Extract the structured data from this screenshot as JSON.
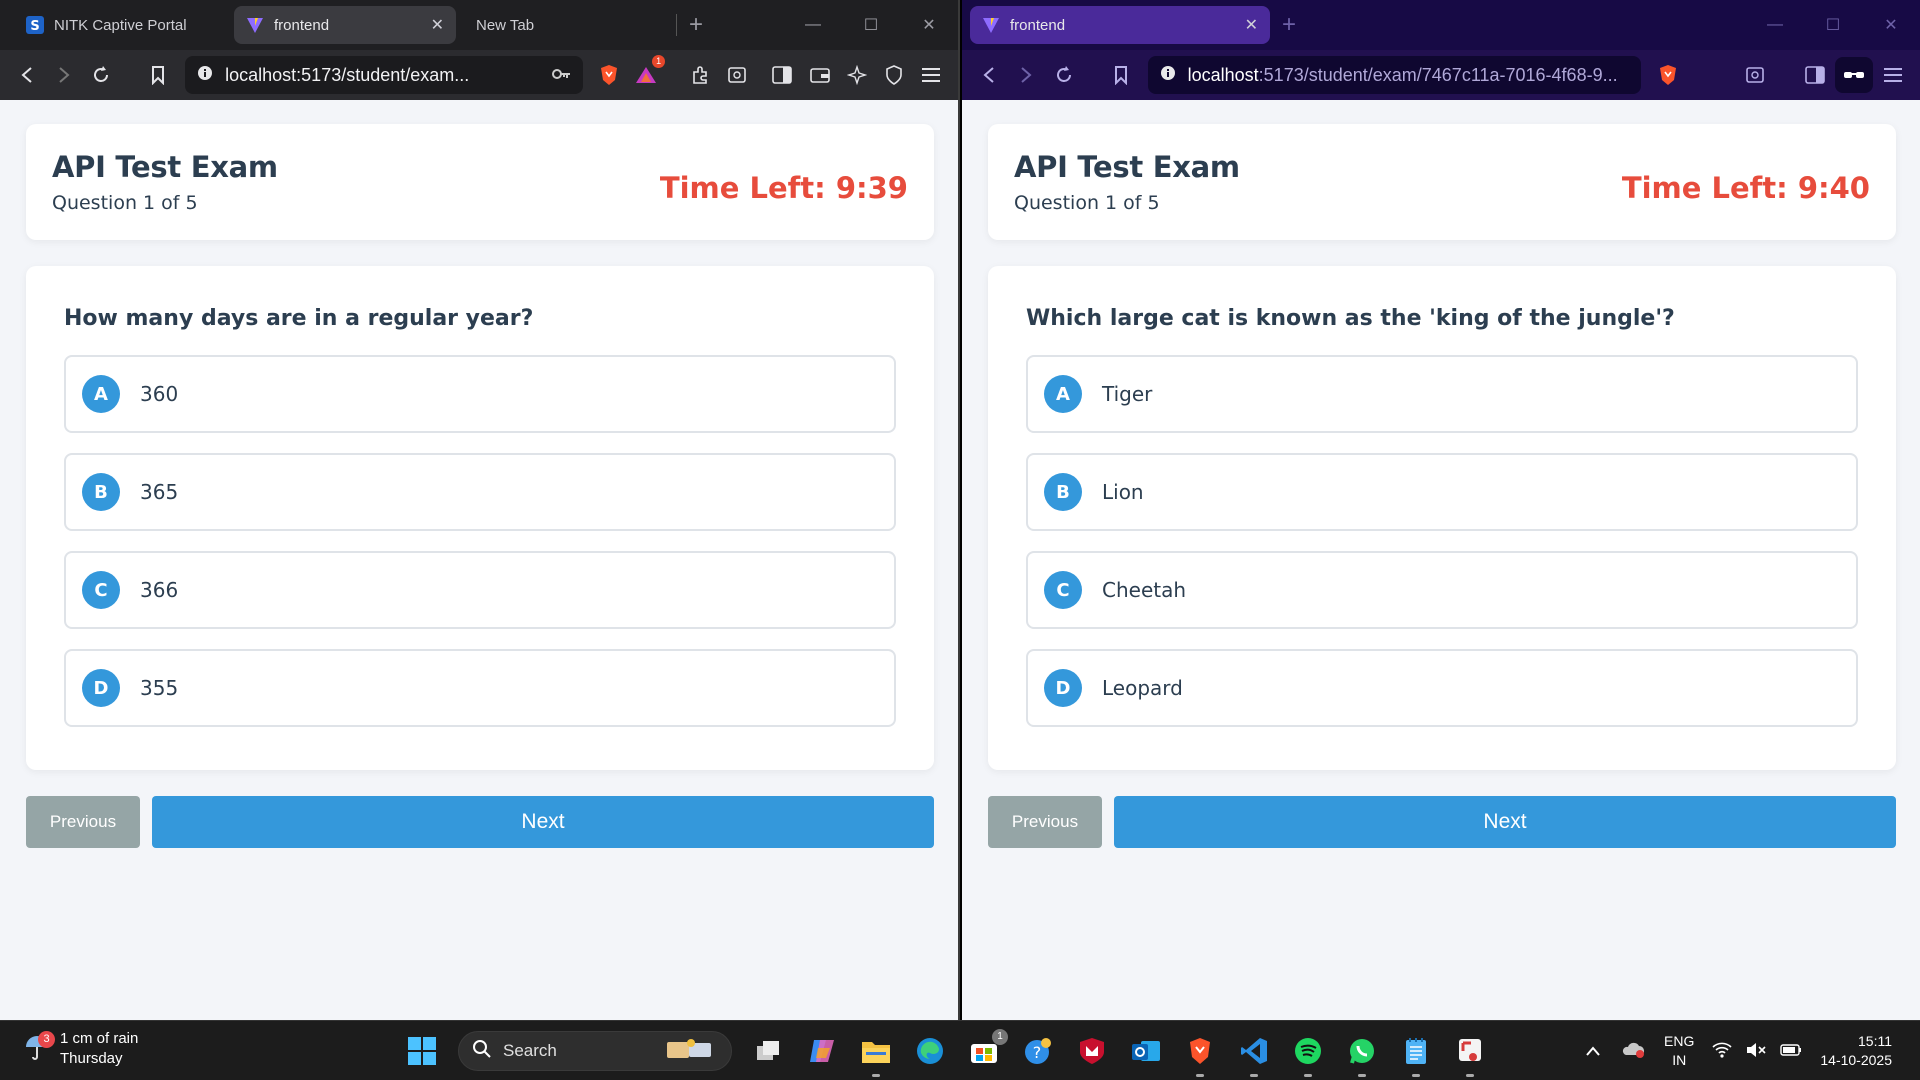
{
  "left_window": {
    "tabs": [
      {
        "title": "NITK Captive Portal"
      },
      {
        "title": "frontend"
      },
      {
        "title": "New Tab"
      }
    ],
    "url": "localhost:5173/student/exam...",
    "notification_count": "1",
    "exam": {
      "title": "API Test Exam",
      "progress": "Question 1 of 5",
      "timer": "Time Left: 9:39",
      "question": "How many days are in a regular year?",
      "options": [
        {
          "letter": "A",
          "text": "360"
        },
        {
          "letter": "B",
          "text": "365"
        },
        {
          "letter": "C",
          "text": "366"
        },
        {
          "letter": "D",
          "text": "355"
        }
      ],
      "prev_label": "Previous",
      "next_label": "Next"
    }
  },
  "right_window": {
    "tabs": [
      {
        "title": "frontend"
      }
    ],
    "url_host": "localhost",
    "url_path": ":5173/student/exam/7467c11a-7016-4f68-9...",
    "exam": {
      "title": "API Test Exam",
      "progress": "Question 1 of 5",
      "timer": "Time Left: 9:40",
      "question": "Which large cat is known as the 'king of the jungle'?",
      "options": [
        {
          "letter": "A",
          "text": "Tiger"
        },
        {
          "letter": "B",
          "text": "Lion"
        },
        {
          "letter": "C",
          "text": "Cheetah"
        },
        {
          "letter": "D",
          "text": "Leopard"
        }
      ],
      "prev_label": "Previous",
      "next_label": "Next"
    }
  },
  "taskbar": {
    "weather_line1": "1 cm of rain",
    "weather_line2": "Thursday",
    "weather_badge": "3",
    "search_placeholder": "Search",
    "store_badge": "1",
    "lang_line1": "ENG",
    "lang_line2": "IN",
    "time": "15:11",
    "date": "14-10-2025"
  },
  "colors": {
    "accent": "#3498db",
    "timer": "#e74c3c",
    "heading": "#2c3e50",
    "previous_button": "#95a5a6",
    "page_bg": "#f3f5f9"
  }
}
